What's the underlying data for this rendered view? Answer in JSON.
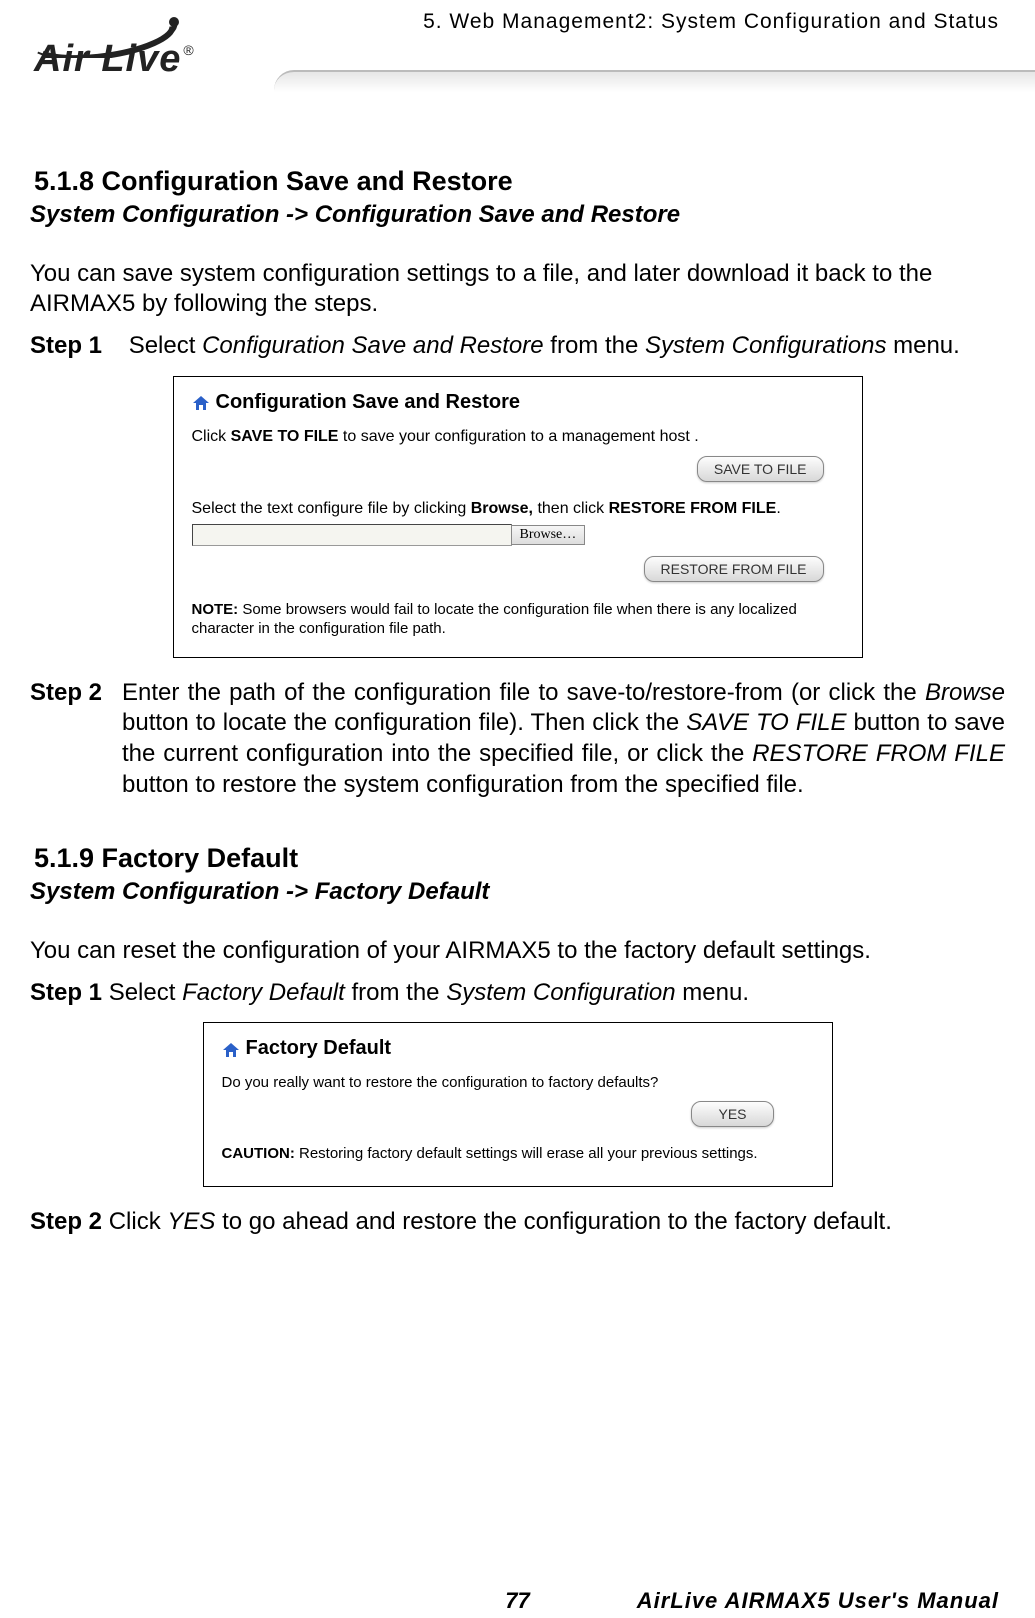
{
  "header": {
    "chapter": "5.  Web Management2: System Configuration and Status",
    "logo_text": "Air Live",
    "logo_reg": "®"
  },
  "section518": {
    "number_title": "5.1.8 Configuration Save and Restore",
    "breadcrumb": "System Configuration -> Configuration Save and Restore",
    "intro": "You can save system configuration settings to a file, and later download it back to the AIRMAX5 by following the steps.",
    "step1_label": "Step 1",
    "step1_pre": "Select ",
    "step1_it1": "Configuration Save and Restore",
    "step1_mid": " from the ",
    "step1_it2": "System Configurations",
    "step1_post": " menu.",
    "panel": {
      "title": "Configuration Save and Restore",
      "line1_pre": "Click ",
      "line1_bold": "SAVE TO FILE",
      "line1_post": " to save your configuration to a management host .",
      "btn_save": "SAVE TO FILE",
      "line2_pre": "Select the text configure file by clicking ",
      "line2_bold1": "Browse,",
      "line2_mid": " then click ",
      "line2_bold2": "RESTORE FROM FILE",
      "line2_post": ".",
      "browse_label": "Browse…",
      "btn_restore": "RESTORE FROM FILE",
      "note_label": "NOTE:",
      "note_text": " Some browsers would fail to locate the configuration file when there is any localized character in the configuration file path."
    },
    "step2_label": "Step 2",
    "step2_a": "Enter the path of the configuration file to save-to/restore-from (or click the ",
    "step2_it1": "Browse",
    "step2_b": " button to locate the configuration file). Then click the ",
    "step2_it2": "SAVE TO FILE",
    "step2_c": " button to save the current configuration into the specified file, or click the ",
    "step2_it3": "RESTORE FROM FILE",
    "step2_d": " button to restore the system configuration from the specified file."
  },
  "section519": {
    "number_title": "5.1.9 Factory Default",
    "breadcrumb": "System Configuration -> Factory Default",
    "intro": "You can reset the configuration of your AIRMAX5 to the factory default settings.",
    "step1_label": "Step 1",
    "step1_pre": " Select ",
    "step1_it1": "Factory Default",
    "step1_mid": " from the ",
    "step1_it2": "System Configuration",
    "step1_post": " menu.",
    "panel": {
      "title": "Factory Default",
      "question": "Do you really want to restore the configuration to factory defaults?",
      "btn_yes": "YES",
      "caution_label": "CAUTION:",
      "caution_text": " Restoring factory default settings will erase all your previous settings."
    },
    "step2_label": "Step 2",
    "step2_pre": " Click ",
    "step2_it": "YES",
    "step2_post": " to go ahead and restore the configuration to the factory default."
  },
  "footer": {
    "page": "77",
    "manual": "AirLive AIRMAX5 User's Manual"
  }
}
